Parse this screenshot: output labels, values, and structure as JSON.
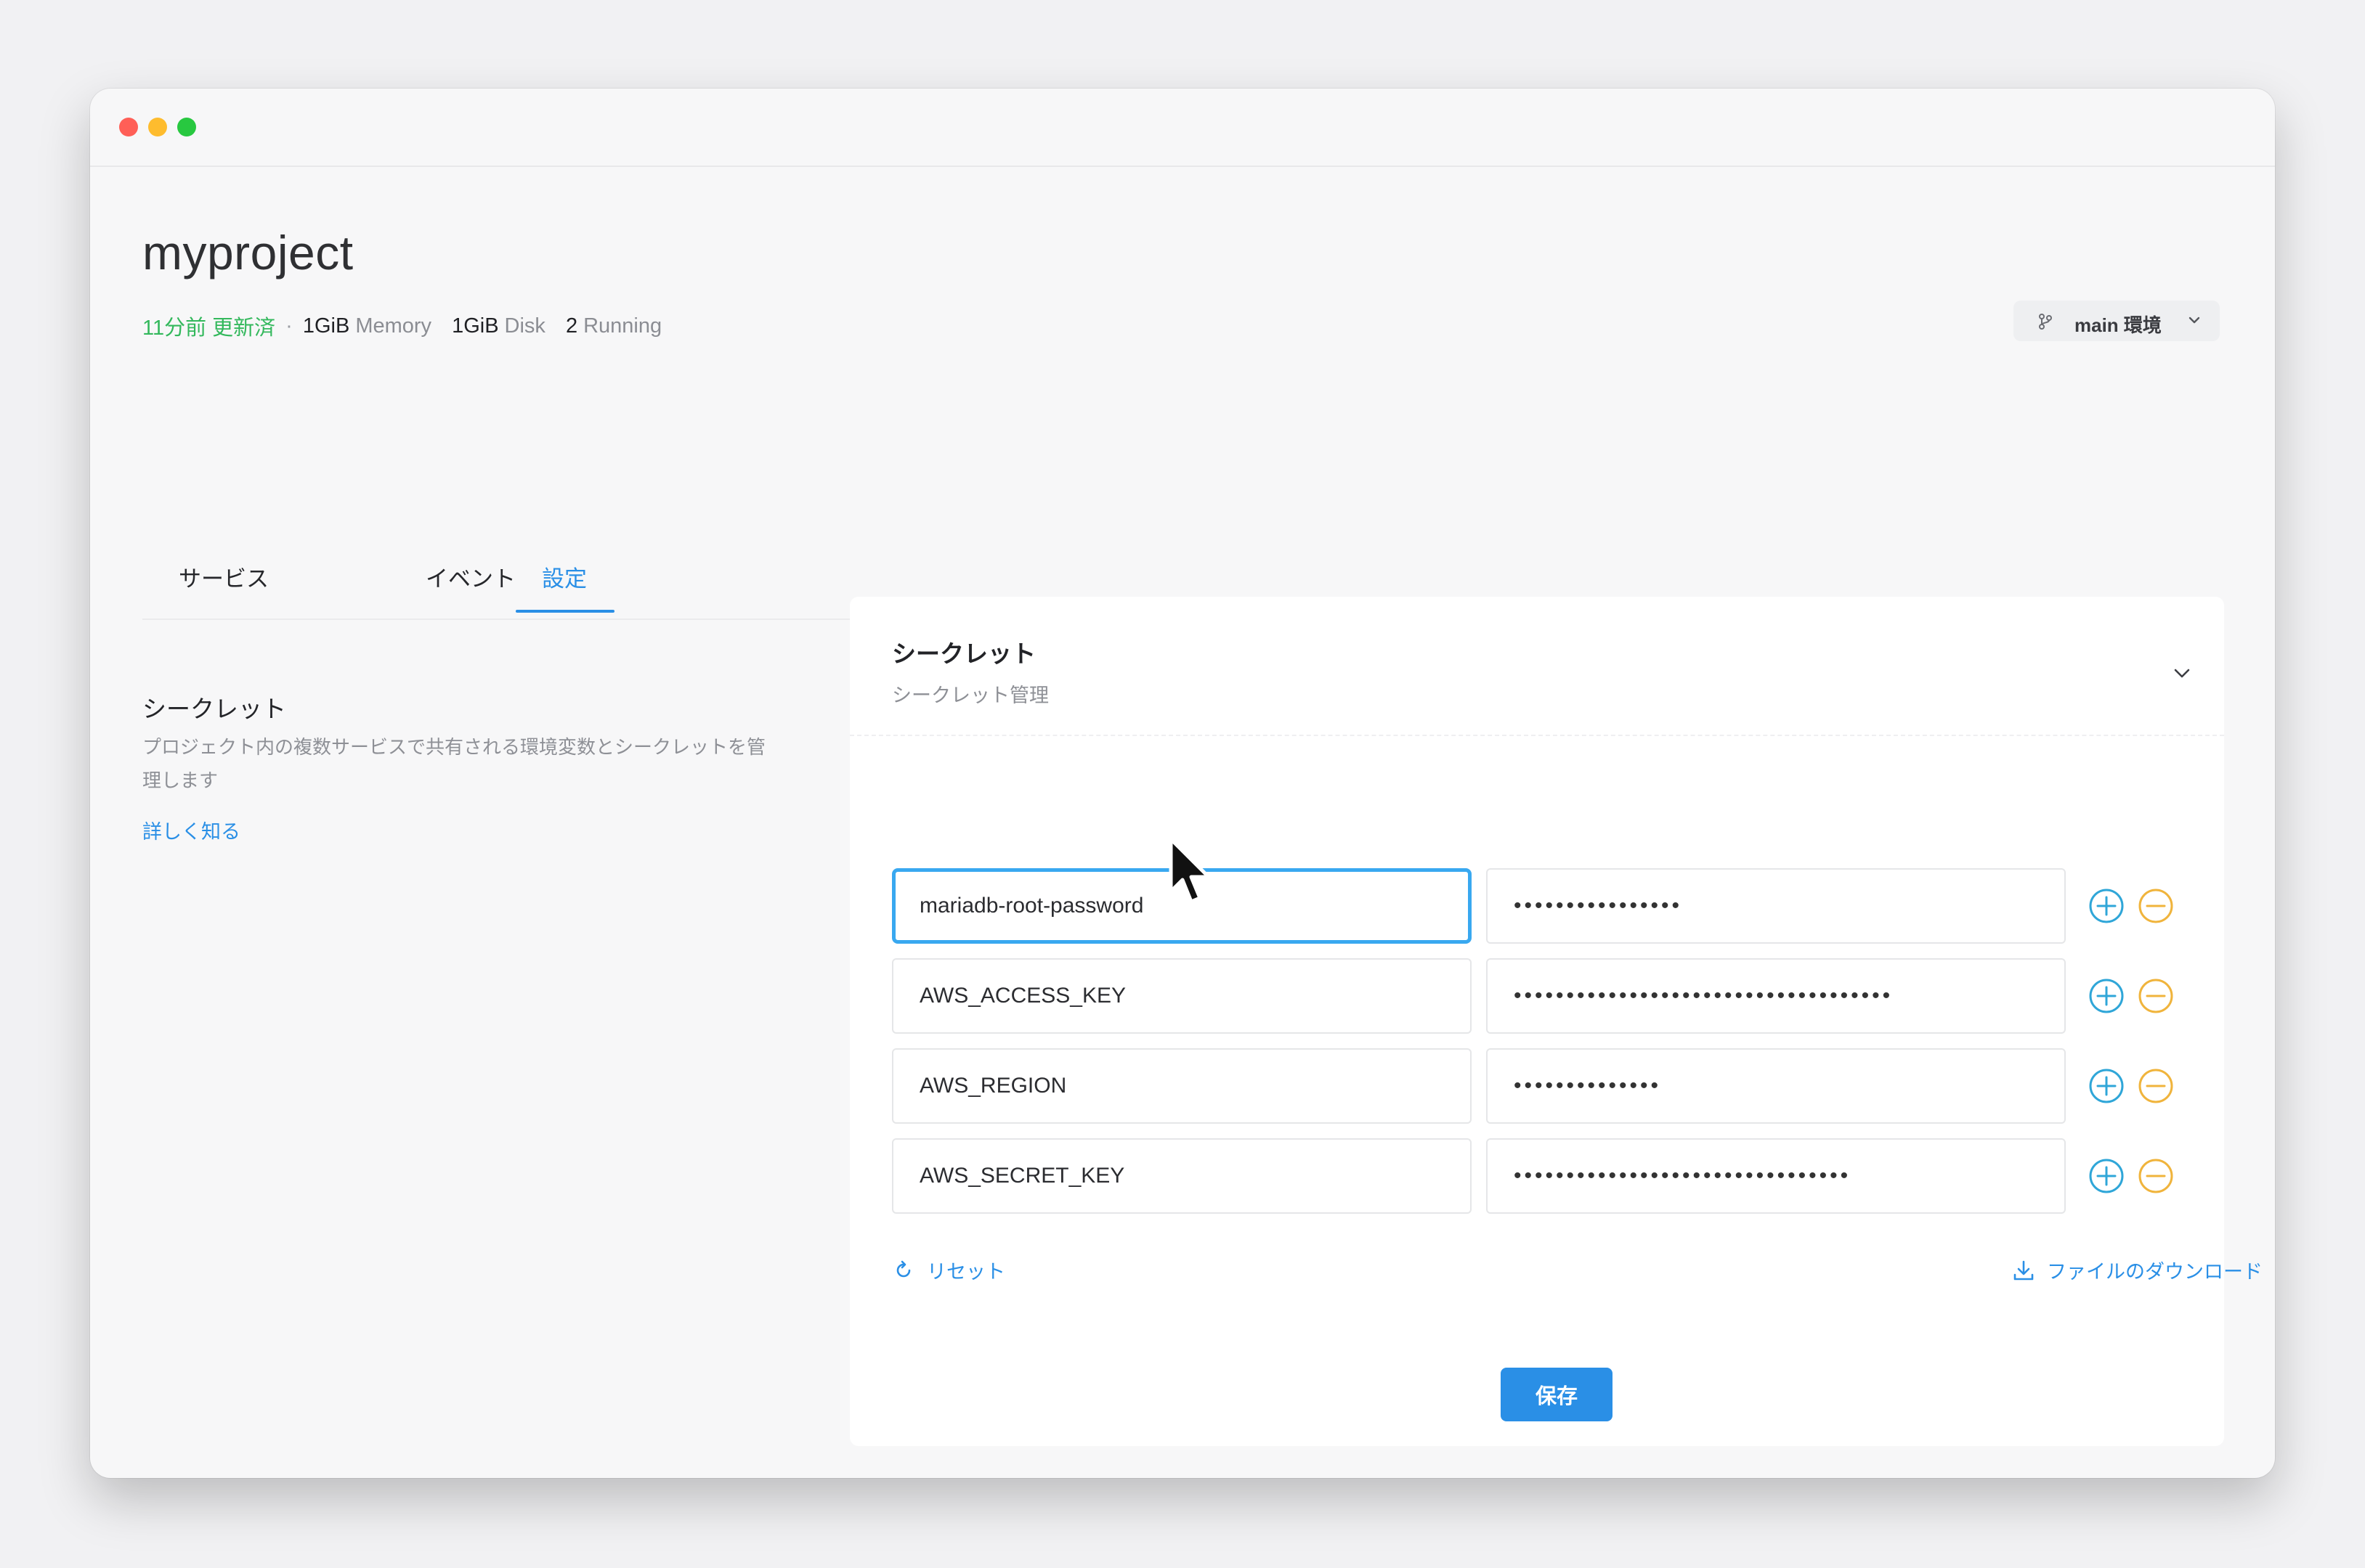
{
  "project": {
    "title": "myproject",
    "updated": "11分前 更新済",
    "separator": "·",
    "memory_value": "1GiB",
    "memory_unit": "Memory",
    "disk_value": "1GiB",
    "disk_unit": "Disk",
    "running_value": "2",
    "running_unit": "Running"
  },
  "branch": {
    "label": "main 環境",
    "icon": "git-branch-icon"
  },
  "tabs": [
    {
      "label": "サービス",
      "active": false
    },
    {
      "label": "イベント",
      "active": false
    },
    {
      "label": "設定",
      "active": true
    }
  ],
  "sidebar": {
    "title": "シークレット",
    "description": "プロジェクト内の複数サービスで共有される環境変数とシークレットを管理します",
    "link": "詳しく知る"
  },
  "card": {
    "title": "シークレット",
    "subtitle": "シークレット管理"
  },
  "secrets": [
    {
      "key": "mariadb-root-password",
      "value": "••••••••••••••••"
    },
    {
      "key": "AWS_ACCESS_KEY",
      "value": "••••••••••••••••••••••••••••••••••••"
    },
    {
      "key": "AWS_REGION",
      "value": "••••••••••••••"
    },
    {
      "key": "AWS_SECRET_KEY",
      "value": "••••••••••••••••••••••••••••••••"
    }
  ],
  "actions": {
    "reset": "リセット",
    "download": "ファイルのダウンロード",
    "save": "保存"
  },
  "colors": {
    "accent": "#2a8fe6",
    "updated_green": "#33b85c",
    "add_icon": "#2fa6d8",
    "remove_icon": "#f0b43c",
    "focus_border": "#39a8f0"
  }
}
